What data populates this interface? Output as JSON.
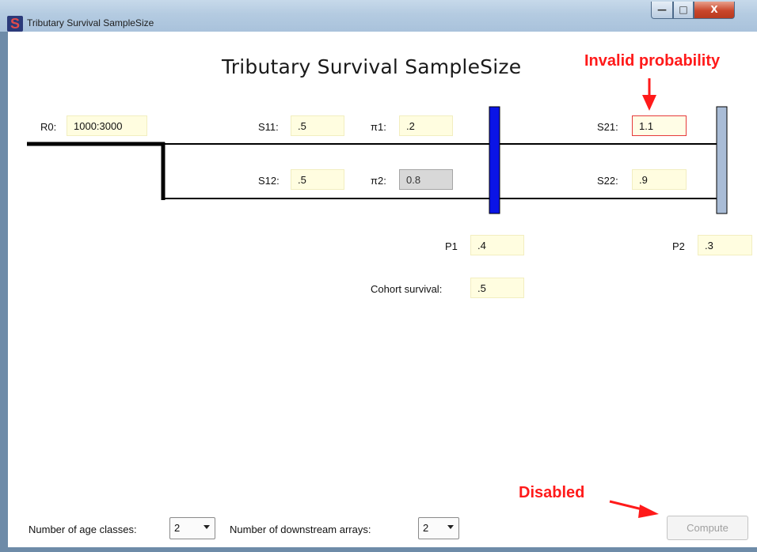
{
  "window": {
    "title": "Tributary Survival SampleSize",
    "app_icon_letter": "S",
    "controls": {
      "minimize": "—",
      "maximize": "□",
      "close": "X"
    }
  },
  "main": {
    "title": "Tributary Survival SampleSize"
  },
  "annotations": {
    "invalid_probability": "Invalid probability",
    "disabled": "Disabled"
  },
  "fields": {
    "r0": {
      "label": "R0:",
      "value": "1000:3000"
    },
    "s11": {
      "label": "S11:",
      "value": ".5"
    },
    "pi1": {
      "label": "π1:",
      "value": ".2"
    },
    "s12": {
      "label": "S12:",
      "value": ".5"
    },
    "pi2": {
      "label": "π2:",
      "value": "0.8"
    },
    "s21": {
      "label": "S21:",
      "value": "1.1"
    },
    "s22": {
      "label": "S22:",
      "value": ".9"
    },
    "p1": {
      "label": "P1",
      "value": ".4"
    },
    "p2": {
      "label": "P2",
      "value": ".3"
    },
    "cohort": {
      "label": "Cohort survival:",
      "value": ".5"
    }
  },
  "footer": {
    "age_classes_label": "Number of age classes:",
    "age_classes_value": "2",
    "arrays_label": "Number of downstream arrays:",
    "arrays_value": "2",
    "compute_label": "Compute"
  },
  "colors": {
    "array1": "#0a14e6",
    "array2": "#a9bcd6",
    "annotation": "#ff1a1a",
    "field_bg": "#fffde0"
  }
}
